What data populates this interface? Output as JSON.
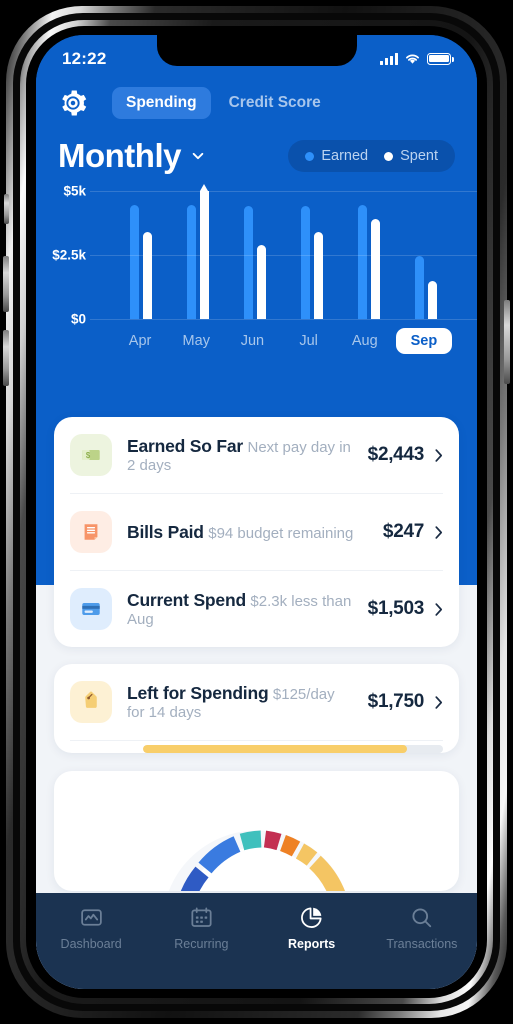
{
  "status_bar": {
    "time": "12:22",
    "signal_icon": "cellular-signal-icon",
    "wifi_icon": "wifi-icon",
    "battery_icon": "battery-icon"
  },
  "header": {
    "settings_icon": "gear-icon",
    "tabs": [
      {
        "label": "Spending",
        "active": true
      },
      {
        "label": "Credit Score",
        "active": false
      }
    ],
    "period_label": "Monthly",
    "period_chevron_icon": "chevron-down-icon",
    "legend": [
      {
        "label": "Earned",
        "color": "#2E90FA"
      },
      {
        "label": "Spent",
        "color": "#FFFFFF"
      }
    ]
  },
  "chart_data": {
    "type": "bar",
    "title": "Monthly",
    "xlabel": "",
    "ylabel": "",
    "categories": [
      "Apr",
      "May",
      "Jun",
      "Jul",
      "Aug",
      "Sep"
    ],
    "selected_category": "Sep",
    "series": [
      {
        "name": "Earned",
        "color": "#2E90FA",
        "values": [
          4450,
          4450,
          4400,
          4400,
          4450,
          2443
        ]
      },
      {
        "name": "Spent",
        "color": "#FFFFFF",
        "values": [
          3400,
          5650,
          2900,
          3400,
          3900,
          1503
        ]
      }
    ],
    "ylim": [
      0,
      5000
    ],
    "ytick_labels": [
      "$5k",
      "$2.5k",
      "$0"
    ],
    "ytick_values": [
      5000,
      2500,
      0
    ],
    "grid": true,
    "legend_position": "top-right",
    "notes": "May Spent bar is clipped by the plot area and drawn with a pointed cap indicating it exceeds $5k"
  },
  "cards": [
    {
      "name": "summary-card",
      "rows": [
        {
          "key": "earned-so-far",
          "icon": "money-bill-icon",
          "icon_bg": "#EDF4DF",
          "icon_color": "#AFCC72",
          "title": "Earned So Far",
          "subtitle": "Next pay day in 2 days",
          "amount": "$2,443",
          "chevron_icon": "chevron-right-icon"
        },
        {
          "key": "bills-paid",
          "icon": "receipt-icon",
          "icon_bg": "#FEEDE4",
          "icon_color": "#F79468",
          "title": "Bills Paid",
          "subtitle": "$94 budget remaining",
          "amount": "$247",
          "chevron_icon": "chevron-right-icon"
        },
        {
          "key": "current-spend",
          "icon": "credit-card-icon",
          "icon_bg": "#DFEDFD",
          "icon_color": "#4D9BEA",
          "title": "Current Spend",
          "subtitle": "$2.3k less than Aug",
          "amount": "$1,503",
          "chevron_icon": "chevron-right-icon"
        }
      ]
    },
    {
      "name": "left-for-spending-card",
      "rows": [
        {
          "key": "left-for-spending",
          "icon": "price-tag-icon",
          "icon_bg": "#FDF1D4",
          "icon_color": "#F2C14E",
          "title": "Left for Spending",
          "subtitle": "$125/day for 14 days",
          "amount": "$1,750",
          "chevron_icon": "chevron-right-icon"
        }
      ],
      "progress": {
        "percent": 88,
        "fill_color": "#F8CE6A",
        "track_color": "#E7EBF0"
      }
    },
    {
      "name": "category-donut-card",
      "donut_segments": [
        {
          "color": "#F4C563"
        },
        {
          "color": "#EE8124"
        },
        {
          "color": "#C32F52"
        },
        {
          "color": "#3FC0BD"
        },
        {
          "color": "#3A7BE0"
        },
        {
          "color": "#2F5BC4"
        }
      ]
    }
  ],
  "bottom_nav": [
    {
      "label": "Dashboard",
      "icon": "activity-chart-icon",
      "active": false
    },
    {
      "label": "Recurring",
      "icon": "calendar-icon",
      "active": false
    },
    {
      "label": "Reports",
      "icon": "pie-chart-icon",
      "active": true
    },
    {
      "label": "Transactions",
      "icon": "search-icon",
      "active": false
    }
  ]
}
